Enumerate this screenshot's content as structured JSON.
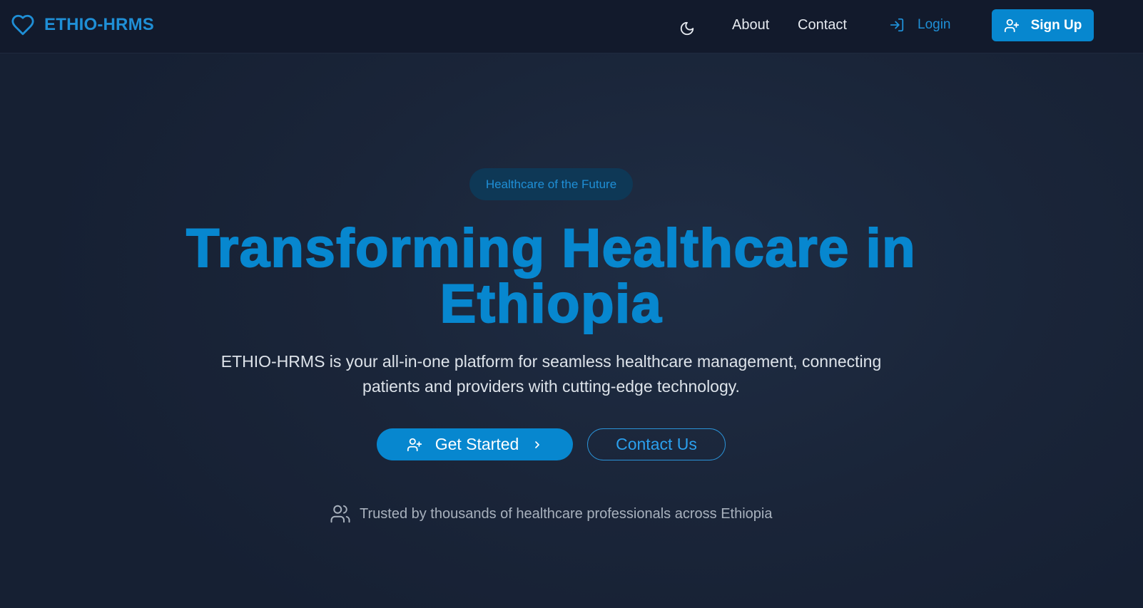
{
  "colors": {
    "accent": "#0787cf",
    "accent_light": "#1f8fd6",
    "background": "#18243a",
    "header_bg": "#121a2c",
    "badge_bg": "#0e3856"
  },
  "header": {
    "brand_icon": "heart-icon",
    "brand_name": "ETHIO-HRMS",
    "theme_toggle_icon": "moon-icon",
    "nav": {
      "about": "About",
      "contact": "Contact",
      "login": "Login",
      "login_icon": "log-in-icon",
      "signup": "Sign Up",
      "signup_icon": "user-plus-icon"
    }
  },
  "hero": {
    "badge": "Healthcare of the Future",
    "title_line1": "Transforming Healthcare in",
    "title_line2": "Ethiopia",
    "description": "ETHIO-HRMS is your all-in-one platform for seamless healthcare management, connecting patients and providers with cutting-edge technology.",
    "primary_button": "Get Started",
    "primary_button_icon": "user-plus-icon",
    "primary_button_trailing_icon": "chevron-right-icon",
    "secondary_button": "Contact Us",
    "trust_icon": "users-icon",
    "trust_text": "Trusted by thousands of healthcare professionals across Ethiopia"
  }
}
